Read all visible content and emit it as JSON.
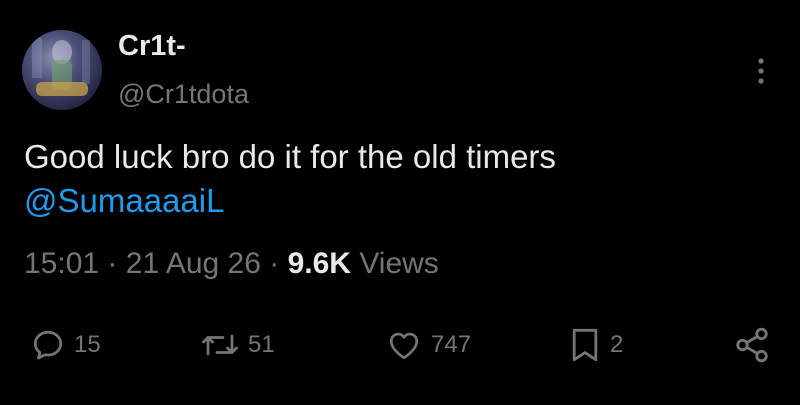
{
  "author": {
    "display_name": "Cr1t-",
    "handle": "@Cr1tdota"
  },
  "tweet": {
    "text": "Good luck bro do it for the old timers",
    "mention": "@SumaaaaiL"
  },
  "meta": {
    "time": "15:01",
    "separator": "·",
    "date": "21 Aug 26",
    "views_count": "9.6K",
    "views_label": "Views"
  },
  "actions": {
    "reply_count": "15",
    "retweet_count": "51",
    "like_count": "747",
    "bookmark_count": "2"
  },
  "icons": {
    "reply": "reply-icon",
    "retweet": "retweet-icon",
    "like": "heart-icon",
    "bookmark": "bookmark-icon",
    "share": "share-icon",
    "more": "more-vertical-icon"
  },
  "colors": {
    "background": "#000000",
    "text": "#e7e9ea",
    "muted": "#71767b",
    "link": "#1d9bf0"
  }
}
